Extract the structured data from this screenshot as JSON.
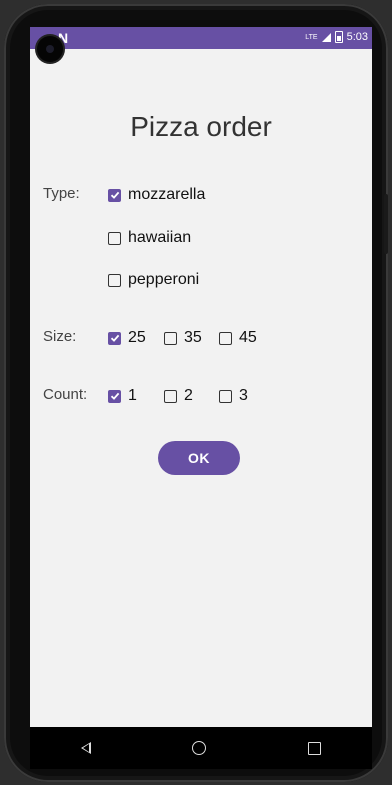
{
  "status_bar": {
    "notification_icon": "N",
    "network": "LTE",
    "time": "5:03"
  },
  "title": "Pizza order",
  "type": {
    "label": "Type:",
    "options": [
      {
        "label": "mozzarella",
        "checked": true
      },
      {
        "label": "hawaiian",
        "checked": false
      },
      {
        "label": "pepperoni",
        "checked": false
      }
    ]
  },
  "size": {
    "label": "Size:",
    "options": [
      {
        "label": "25",
        "checked": true
      },
      {
        "label": "35",
        "checked": false
      },
      {
        "label": "45",
        "checked": false
      }
    ]
  },
  "count": {
    "label": "Count:",
    "options": [
      {
        "label": "1",
        "checked": true
      },
      {
        "label": "2",
        "checked": false
      },
      {
        "label": "3",
        "checked": false
      }
    ]
  },
  "ok_button": {
    "label": "OK"
  },
  "colors": {
    "accent": "#6750a4",
    "background": "#f2f2f2"
  },
  "nav_icons": [
    "back-icon",
    "home-icon",
    "recents-icon"
  ]
}
